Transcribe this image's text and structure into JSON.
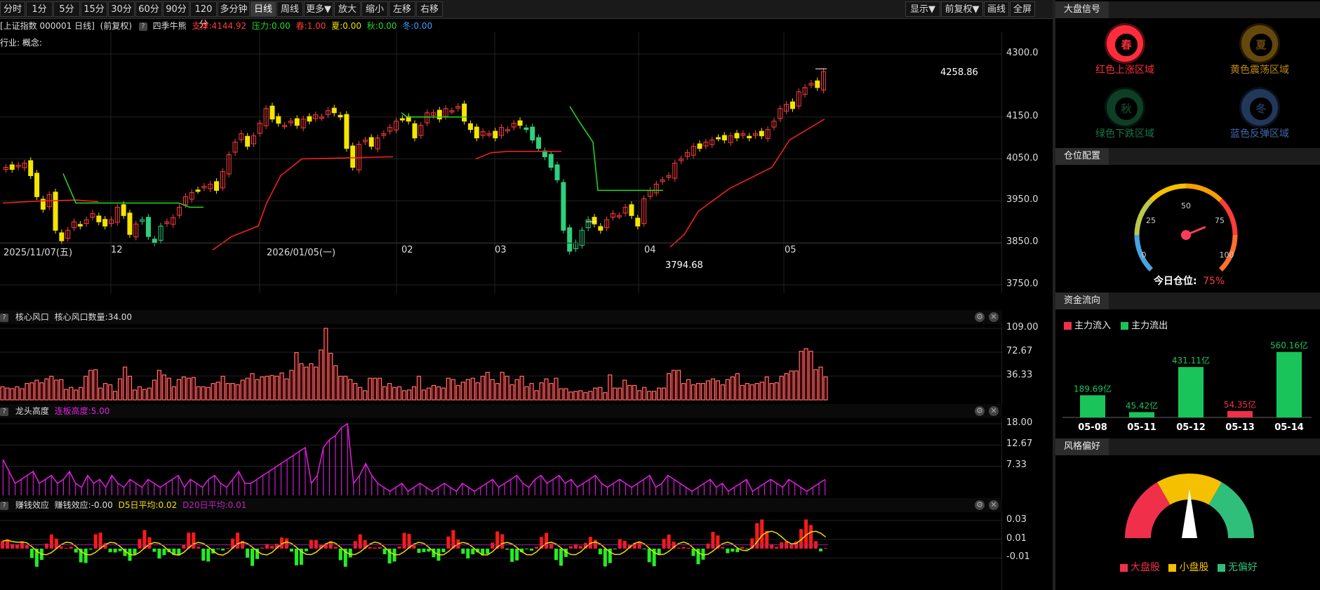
{
  "toolbar": {
    "periods": [
      "分时",
      "1分",
      "5分",
      "15分",
      "30分",
      "60分",
      "90分",
      "120分",
      "多分钟",
      "日线",
      "周线",
      "更多▼",
      "放大",
      "缩小",
      "左移",
      "右移"
    ],
    "active": "日线",
    "right_buttons": [
      "显示▼",
      "前复权▼",
      "画线",
      "全屏"
    ]
  },
  "infobar": {
    "symbol": "[上证指数 000001 日线]",
    "adjust": "(前复权)",
    "indicator_name": "四季牛熊",
    "support": "支撑:4144.92",
    "pressure": "压力:0.00",
    "spring": "春:1.00",
    "summer": "夏:0.00",
    "autumn": "秋:0.00",
    "winter": "冬:0.00",
    "industry": "行业: 概念:"
  },
  "main_chart": {
    "y_ticks": [
      "4300.0",
      "4150.0",
      "4050.0",
      "3950.0",
      "3850.0",
      "3750.0"
    ],
    "high_label": "4258.86",
    "low_label": "3794.68",
    "dates": [
      "2025/11/07(五)",
      "12",
      "2026/01/05(一)",
      "02",
      "03",
      "04",
      "05"
    ]
  },
  "panel1": {
    "title": "核心风口",
    "subtitle": "核心风口数量:34.00",
    "y_ticks": [
      "109.00",
      "72.67",
      "36.33"
    ],
    "values": [
      20,
      18,
      17,
      20,
      17,
      25,
      26,
      30,
      26,
      32,
      36,
      30,
      31,
      16,
      19,
      15,
      19,
      36,
      45,
      46,
      18,
      25,
      23,
      13,
      32,
      50,
      36,
      15,
      20,
      16,
      18,
      30,
      45,
      38,
      33,
      20,
      31,
      35,
      33,
      34,
      20,
      20,
      19,
      25,
      27,
      36,
      25,
      25,
      23,
      30,
      33,
      40,
      31,
      35,
      36,
      37,
      36,
      41,
      32,
      45,
      72,
      55,
      50,
      55,
      50,
      76,
      109,
      71,
      52,
      36,
      36,
      31,
      25,
      19,
      14,
      33,
      33,
      33,
      20,
      25,
      19,
      20,
      14,
      15,
      20,
      36,
      15,
      18,
      22,
      20,
      18,
      33,
      31,
      22,
      27,
      31,
      33,
      26,
      36,
      42,
      31,
      25,
      42,
      36,
      23,
      31,
      36,
      20,
      25,
      14,
      26,
      32,
      25,
      33,
      17,
      17,
      12,
      13,
      14,
      11,
      13,
      18,
      19,
      11,
      38,
      18,
      18,
      30,
      22,
      22,
      14,
      19,
      13,
      13,
      18,
      18,
      40,
      45,
      45,
      25,
      31,
      23,
      25,
      25,
      29,
      32,
      29,
      23,
      31,
      35,
      40,
      22,
      25,
      23,
      25,
      27,
      35,
      25,
      26,
      36,
      40,
      44,
      44,
      74,
      78,
      74,
      46,
      50,
      35
    ]
  },
  "panel2": {
    "title": "龙头高度",
    "subtitle": "连板高度:5.00",
    "y_ticks": [
      "18.00",
      "12.67",
      "7.33"
    ],
    "values": [
      9,
      6,
      3,
      4,
      5,
      6,
      3,
      4,
      5,
      3,
      4,
      6,
      3,
      2,
      5,
      3,
      4,
      2,
      5,
      3,
      2,
      4,
      3,
      2,
      4,
      3,
      2,
      3,
      4,
      5,
      2,
      4,
      3,
      2,
      4,
      5,
      3,
      2,
      4,
      6,
      3,
      3,
      4,
      5,
      6,
      7,
      8,
      9,
      10,
      11,
      12,
      3,
      5,
      12,
      14,
      15,
      17,
      18,
      3,
      5,
      8,
      5,
      3,
      2,
      1,
      2,
      3,
      1,
      2,
      3,
      2,
      1,
      2,
      3,
      2,
      1,
      3,
      2,
      1,
      2,
      3,
      4,
      2,
      3,
      4,
      5,
      3,
      2,
      4,
      5,
      3,
      4,
      5,
      3,
      4,
      2,
      3,
      4,
      5,
      3,
      2,
      3,
      4,
      3,
      2,
      3,
      4,
      5,
      2,
      3,
      5,
      4,
      3,
      2,
      1,
      2,
      3,
      4,
      2,
      3,
      1,
      2,
      3,
      4,
      1,
      2,
      3,
      4,
      3,
      2,
      4,
      3,
      2,
      1,
      2,
      3,
      4
    ]
  },
  "panel3": {
    "title": "赚钱效应",
    "subtitle": "赚钱效应:-0.00",
    "d5": "D5日平均:0.02",
    "d20": "D20日平均:0.01",
    "y_ticks": [
      "0.03",
      "0.01",
      "-0.01"
    ]
  },
  "right_panel": {
    "signal_title": "大盘信号",
    "seasons": [
      {
        "char": "春",
        "label": "红色上涨区域",
        "color": "#ff2d3b",
        "active": true
      },
      {
        "char": "夏",
        "label": "黄色震荡区域",
        "color": "#e0a11b",
        "active": false
      },
      {
        "char": "秋",
        "label": "绿色下跌区域",
        "color": "#1f8a56",
        "active": false
      },
      {
        "char": "冬",
        "label": "蓝色反弹区域",
        "color": "#4c7cc9",
        "active": false
      }
    ],
    "position_title": "仓位配置",
    "gauge_ticks": [
      "0",
      "25",
      "50",
      "75",
      "100"
    ],
    "position_label": "今日仓位:",
    "position_value": "75%",
    "position_fraction": 0.75,
    "flow_title": "资金流向",
    "flow_legend_in": "主力流入",
    "flow_legend_out": "主力流出",
    "flow_bars": [
      {
        "date": "05-08",
        "value": 189.69,
        "label": "189.69亿",
        "dir": "out"
      },
      {
        "date": "05-11",
        "value": 45.42,
        "label": "45.42亿",
        "dir": "out"
      },
      {
        "date": "05-12",
        "value": 431.11,
        "label": "431.11亿",
        "dir": "out"
      },
      {
        "date": "05-13",
        "value": 54.35,
        "label": "54.35亿",
        "dir": "in"
      },
      {
        "date": "05-14",
        "value": 560.16,
        "label": "560.16亿",
        "dir": "out"
      }
    ],
    "style_title": "风格偏好",
    "style_legend": [
      "大盘股",
      "小盘股",
      "无偏好"
    ],
    "style_colors": [
      "#f0304a",
      "#f5c000",
      "#2fbf7a"
    ]
  }
}
